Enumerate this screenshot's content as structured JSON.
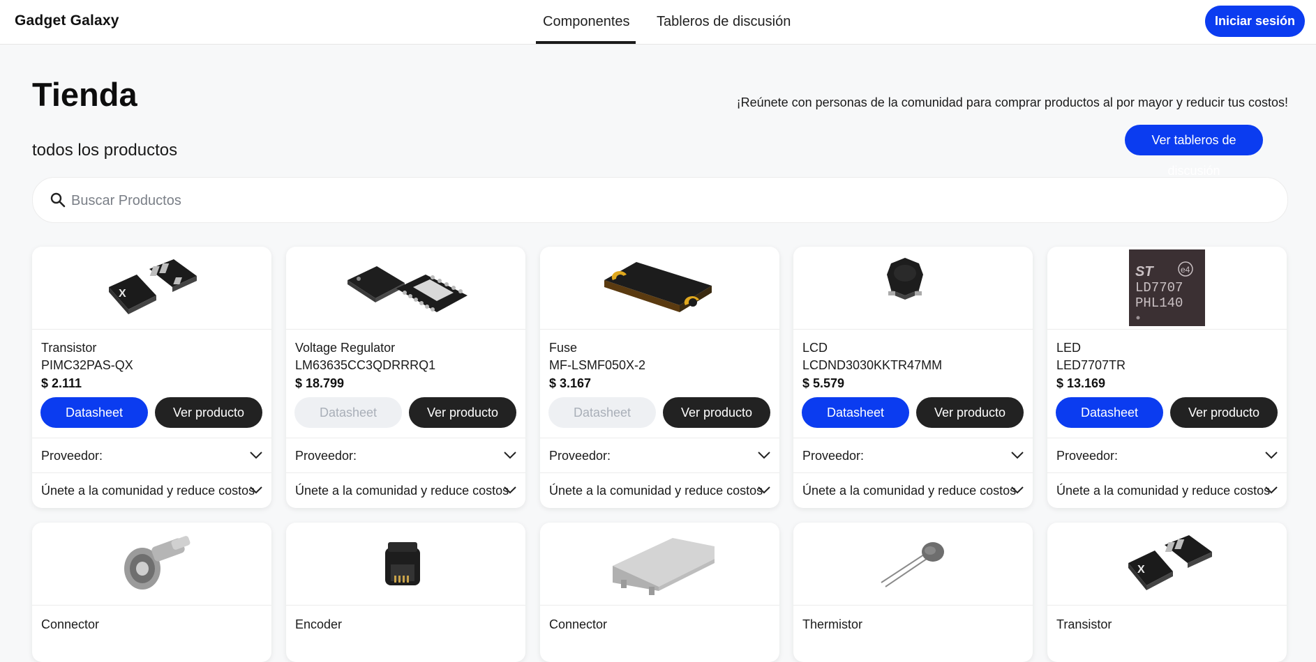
{
  "header": {
    "logo": "Gadget Galaxy",
    "tabs": [
      {
        "label": "Componentes",
        "active": true
      },
      {
        "label": "Tableros de discusión",
        "active": false
      }
    ],
    "login_label": "Iniciar sesión"
  },
  "page": {
    "title": "Tienda",
    "subtitle": "todos los productos",
    "promo_text": "¡Reúnete con personas de la comunidad para comprar productos al por mayor y reducir tus costos!",
    "forums_button": "Ver tableros de discusión",
    "search_placeholder": "Buscar Productos"
  },
  "card_labels": {
    "datasheet": "Datasheet",
    "view_product": "Ver producto",
    "supplier": "Proveedor:",
    "community": "Únete a la comunidad y reduce costos"
  },
  "products": [
    {
      "category": "Transistor",
      "part": "PIMC32PAS-QX",
      "price": "$ 2.111",
      "datasheet_enabled": true,
      "image_icon": "dfn-package-icon"
    },
    {
      "category": "Voltage Regulator",
      "part": "LM63635CC3QDRRRQ1",
      "price": "$ 18.799",
      "datasheet_enabled": false,
      "image_icon": "son-package-icon"
    },
    {
      "category": "Fuse",
      "part": "MF-LSMF050X-2",
      "price": "$ 3.167",
      "datasheet_enabled": false,
      "image_icon": "smd-fuse-icon"
    },
    {
      "category": "LCD",
      "part": "LCDND3030KKTR47MM",
      "price": "$ 5.579",
      "datasheet_enabled": true,
      "image_icon": "smd-inductor-icon"
    },
    {
      "category": "LED",
      "part": "LED7707TR",
      "price": "$ 13.169",
      "datasheet_enabled": true,
      "image_icon": "qfn-chip-icon"
    },
    {
      "category": "Connector",
      "image_icon": "bnc-connector-icon"
    },
    {
      "category": "Encoder",
      "image_icon": "encoder-icon"
    },
    {
      "category": "Connector",
      "image_icon": "housing-connector-icon"
    },
    {
      "category": "Thermistor",
      "image_icon": "thermistor-icon"
    },
    {
      "category": "Transistor",
      "image_icon": "dfn-package-icon"
    }
  ],
  "chip_marking": {
    "line1": "LD7707",
    "line2": "PHL140",
    "logo": "ST",
    "badge": "e4"
  },
  "colors": {
    "accent": "#0b3cf0",
    "dark_button": "#222222",
    "disabled_button": "#eef0f3"
  }
}
